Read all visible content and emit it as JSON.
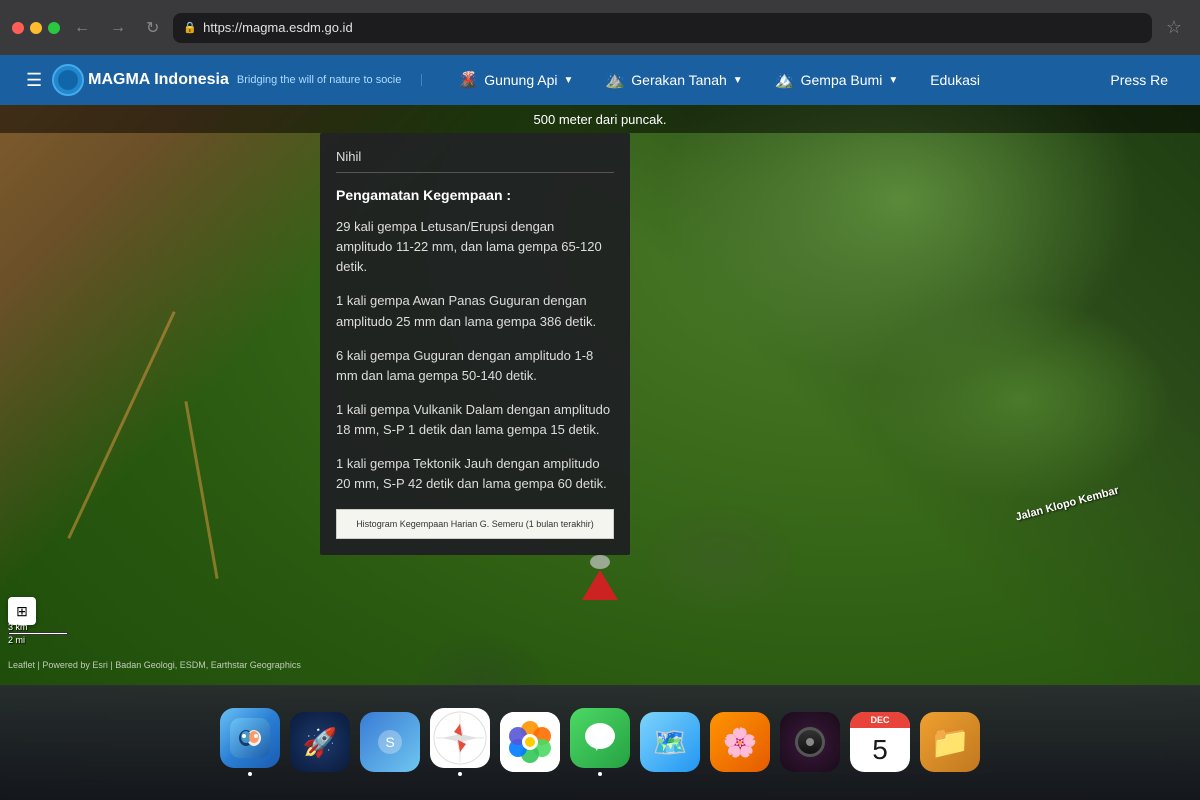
{
  "browser": {
    "url": "https://magma.esdm.go.id",
    "back_btn": "←",
    "forward_btn": "→",
    "refresh_btn": "↻"
  },
  "navbar": {
    "title": "MAGMA Indonesia",
    "subtitle": "Bridging the will of nature to socie",
    "menu_icon": "☰",
    "items": [
      {
        "label": "Gunung Api",
        "icon": "🌋",
        "has_dropdown": true
      },
      {
        "label": "Gerakan Tanah",
        "icon": "⛰️",
        "has_dropdown": true
      },
      {
        "label": "Gempa Bumi",
        "icon": "🏔️",
        "has_dropdown": true
      },
      {
        "label": "Edukasi",
        "has_dropdown": false
      },
      {
        "label": "Press Re",
        "has_dropdown": false
      }
    ]
  },
  "top_strip": {
    "text": "500 meter dari puncak."
  },
  "info_panel": {
    "nihil_label": "Nihil",
    "section_title": "Pengamatan Kegempaan :",
    "paragraphs": [
      "29 kali gempa Letusan/Erupsi dengan amplitudo 11-22 mm, dan lama gempa 65-120 detik.",
      "1 kali gempa Awan Panas Guguran dengan amplitudo 25 mm dan lama gempa 386 detik.",
      "6 kali gempa Guguran dengan amplitudo 1-8 mm dan lama gempa 50-140 detik.",
      "1 kali gempa Vulkanik Dalam dengan amplitudo 18 mm, S-P 1 detik dan lama gempa 15 detik.",
      "1 kali gempa Tektonik Jauh dengan amplitudo 20 mm, S-P 42 detik dan lama gempa 60 detik."
    ],
    "chart_label": "Histogram Kegempaan Harian G. Semeru (1 bulan terakhir)"
  },
  "map": {
    "attribution": "Leaflet | Powered by Esri | Badan Geologi, ESDM, Earthstar Geographics",
    "scale_labels": [
      "3 km",
      "2 mi"
    ],
    "road_label": "Jalan Klopo Kembar"
  },
  "dock": {
    "items": [
      {
        "name": "finder",
        "emoji": "😊",
        "color_class": "icon-finder",
        "active": true
      },
      {
        "name": "launchpad",
        "emoji": "🚀",
        "color_class": "icon-launchpad",
        "active": false
      },
      {
        "name": "siri",
        "emoji": "🔵",
        "color_class": "icon-siri",
        "active": false
      },
      {
        "name": "safari",
        "emoji": "🧭",
        "color_class": "icon-safari",
        "active": true
      },
      {
        "name": "photos",
        "emoji": "📷",
        "color_class": "icon-photos",
        "active": false
      },
      {
        "name": "messages",
        "emoji": "💬",
        "color_class": "icon-messages",
        "active": true
      },
      {
        "name": "maps",
        "emoji": "🗺️",
        "color_class": "icon-maps",
        "active": false
      },
      {
        "name": "photos2",
        "emoji": "🌸",
        "color_class": "icon-photos2",
        "active": false
      },
      {
        "name": "music",
        "emoji": "🎵",
        "color_class": "icon-music",
        "active": false
      },
      {
        "name": "calendar",
        "emoji": "DEC",
        "color_class": "icon-calendar",
        "active": false,
        "date": "5"
      },
      {
        "name": "folder",
        "emoji": "📁",
        "color_class": "icon-finder-orange",
        "active": false
      }
    ]
  }
}
